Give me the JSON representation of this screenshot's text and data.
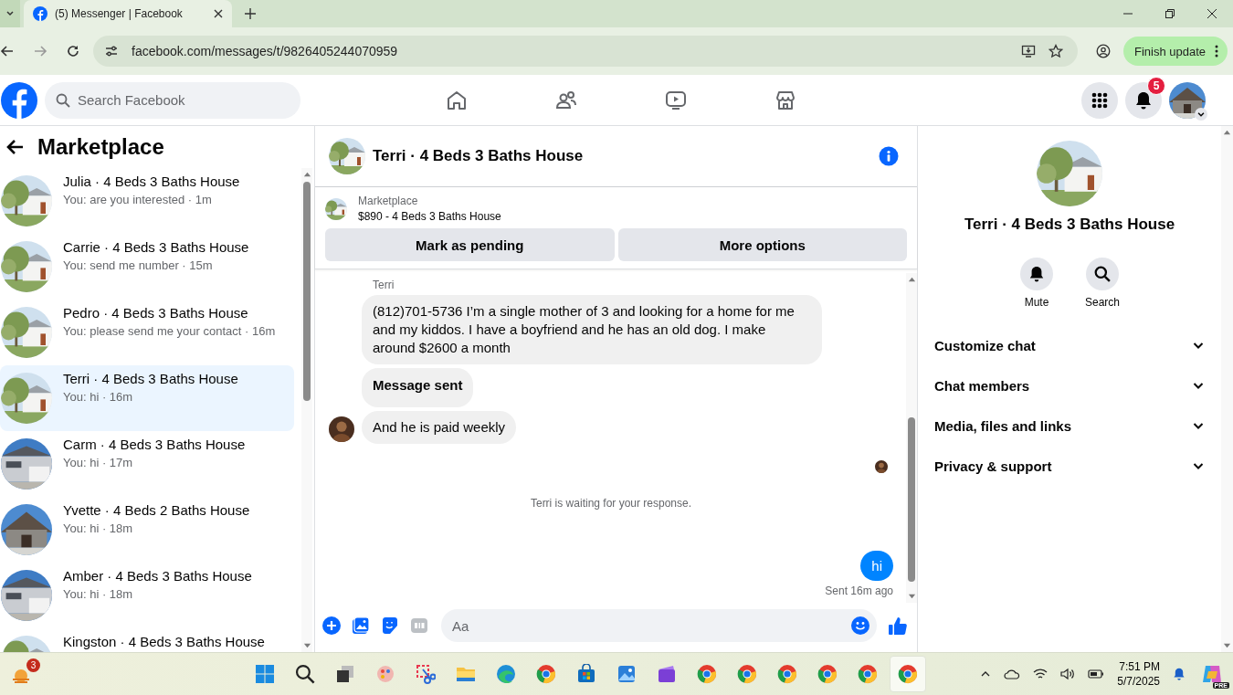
{
  "browser": {
    "tabs": [
      {
        "title": "(5) Messenger | Facebook",
        "selected": true
      }
    ],
    "url": "facebook.com/messages/t/9826405244070959",
    "update_button": "Finish update"
  },
  "header": {
    "search": {
      "placeholder": "Search Facebook"
    },
    "nav": [
      {
        "kind": "home",
        "selected": false
      },
      {
        "kind": "friends",
        "selected": false
      },
      {
        "kind": "video",
        "selected": false
      },
      {
        "kind": "marketplace",
        "selected": false
      }
    ],
    "notifications_badge": "5"
  },
  "sidebar": {
    "title": "Marketplace",
    "conversations": [
      {
        "name": "Julia · 4 Beds 3 Baths House",
        "preview": "You: are you interested · 1m",
        "selected": false
      },
      {
        "name": "Carrie · 4 Beds 3 Baths House",
        "preview": "You: send me number · 15m",
        "selected": false
      },
      {
        "name": "Pedro · 4 Beds 3 Baths House",
        "preview": "You: please send me your contact · 16m",
        "selected": false
      },
      {
        "name": "Terri · 4 Beds 3 Baths House",
        "preview": "You: hi · 16m",
        "selected": true
      },
      {
        "name": "Carm · 4 Beds 3 Baths House",
        "preview": "You: hi · 17m",
        "selected": false
      },
      {
        "name": "Yvette · 4 Beds 2 Baths House",
        "preview": "You: hi · 18m",
        "selected": false
      },
      {
        "name": "Amber · 4 Beds 3 Baths House",
        "preview": "You: hi · 18m",
        "selected": false
      },
      {
        "name": "Kingston · 4 Beds 3 Baths House",
        "selected": false
      }
    ]
  },
  "chat": {
    "title": "Terri · 4 Beds 3 Baths House",
    "listing": {
      "label": "Marketplace",
      "title": "$890 - 4 Beds 3 Baths House"
    },
    "buttons": [
      "Mark as pending",
      "More options"
    ],
    "sender": "Terri",
    "messages": [
      {
        "text": "(812)701-5736 I’m a single mother of 3 and looking for a home for me and my kiddos. I have a boyfriend and he has an old dog. I make around $2600 a month",
        "emphasis": false
      },
      {
        "text": "Message sent",
        "emphasis": true
      },
      {
        "text": "And he is paid weekly",
        "emphasis": false
      }
    ],
    "status": "Terri is waiting for your response.",
    "reply": "hi",
    "reply_status": "Sent 16m ago",
    "composer": {
      "placeholder": "Aa"
    }
  },
  "details": {
    "name": "Terri · 4 Beds 3 Baths House",
    "actions": [
      {
        "kind": "mute",
        "label": "Mute"
      },
      {
        "kind": "search",
        "label": "Search"
      }
    ],
    "sections": [
      "Customize chat",
      "Chat members",
      "Media, files and links",
      "Privacy & support"
    ]
  },
  "taskbar": {
    "weather_badge": "3",
    "apps": [
      {
        "kind": "start",
        "selected": false
      },
      {
        "kind": "search",
        "selected": false
      },
      {
        "kind": "taskview",
        "selected": false
      },
      {
        "kind": "paint",
        "selected": false
      },
      {
        "kind": "snip",
        "selected": false
      },
      {
        "kind": "folder",
        "selected": false
      },
      {
        "kind": "edge",
        "selected": false
      },
      {
        "kind": "chrome",
        "selected": false
      },
      {
        "kind": "store",
        "selected": false
      },
      {
        "kind": "photos",
        "selected": false
      },
      {
        "kind": "clipchamp",
        "selected": false
      },
      {
        "kind": "chrome",
        "selected": false
      },
      {
        "kind": "chrome",
        "selected": false
      },
      {
        "kind": "chrome",
        "selected": false
      },
      {
        "kind": "chrome",
        "selected": false
      },
      {
        "kind": "chrome",
        "selected": false
      },
      {
        "kind": "chrome",
        "selected": true
      }
    ],
    "time": "7:51 PM",
    "date": "5/7/2025",
    "copilot_badge": "PRE"
  }
}
